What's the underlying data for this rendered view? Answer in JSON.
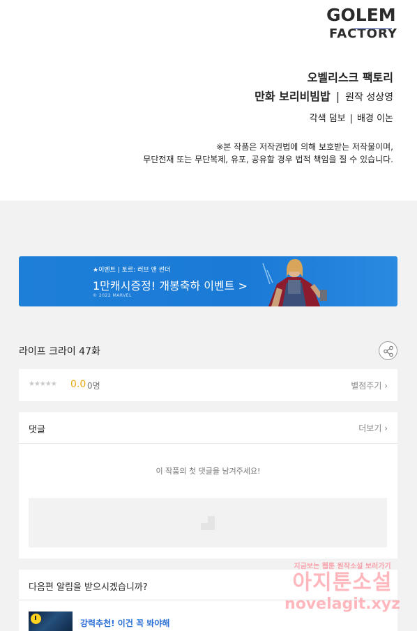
{
  "credits": {
    "logo_line1": "GOLEM",
    "logo_line2": "FACTORY",
    "studio": "오벨리스크 팩토리",
    "comic_credit": "만화 보리비빔밥",
    "separator": "|",
    "original_credit": "원작 성상영",
    "coloring_credit": "각색 덤보",
    "background_credit": "배경 이논",
    "notice_line1": "※본 작품은 저작권법에 의해 보호받는 저작물이며,",
    "notice_line2": "무단전재 또는 무단복제, 유포, 공유할 경우 법적 책임을 질 수 있습니다."
  },
  "banner": {
    "tag": "★이벤트 | 토르: 러브 앤 썬더",
    "headline": "1만캐시증정! 개봉축하 이벤트 >",
    "copyright": "© 2022 MARVEL"
  },
  "episode": {
    "title": "라이프 크라이 47화",
    "share_icon": "share-icon"
  },
  "rating": {
    "stars": "★★★★★",
    "score": "0.0",
    "count": "0명",
    "rate_link": "별점주기 ›"
  },
  "comments": {
    "title": "댓글",
    "more_link": "더보기 ›",
    "empty_message": "이 작품의 첫 댓글을 남겨주세요!"
  },
  "notify": {
    "question": "다음편 알림을 받으시겠습니까?",
    "recommend": "강력추천! 이건 꼭 봐야해"
  },
  "watermark": {
    "line1": "지금보는 웹툰 원작소설 보러가기",
    "line2": "아지툰소설",
    "line3": "novelagit.xyz"
  },
  "colors": {
    "banner_blue": "#1e7fd8",
    "score_yellow": "#e8a70f",
    "recommend_blue": "#2a6fd6",
    "page_gray": "#f2f2f2"
  }
}
